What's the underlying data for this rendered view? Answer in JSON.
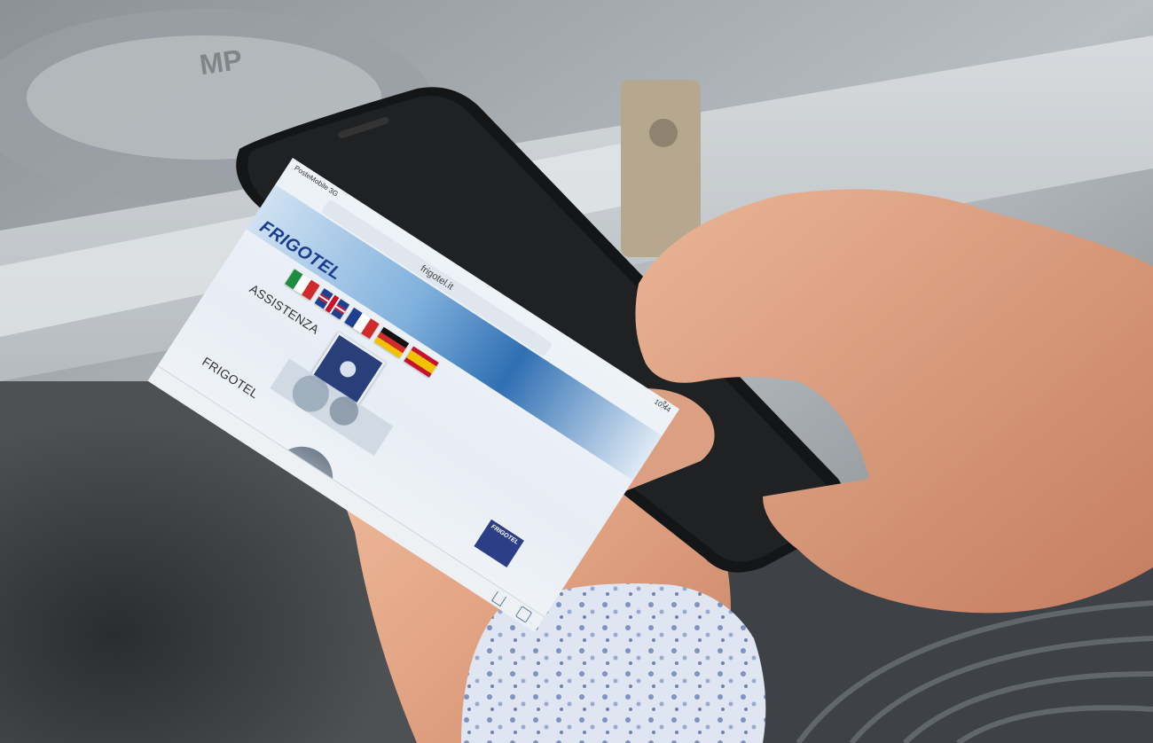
{
  "status_bar": {
    "carrier": "PosteMobile 3G",
    "time": "10:44"
  },
  "browser": {
    "url": "frigotel.it"
  },
  "site": {
    "brand": "FRIGOTEL",
    "sections": [
      {
        "title": "ASSISTENZA"
      },
      {
        "title": "FRIGOTEL"
      }
    ],
    "badge_text": "FRIGOTEL"
  },
  "background_label": "MP",
  "icons": [
    "reload-icon",
    "share-icon",
    "tabs-icon",
    "flag-it-icon",
    "flag-uk-icon",
    "flag-fr-icon",
    "flag-de-icon",
    "flag-es-icon"
  ]
}
